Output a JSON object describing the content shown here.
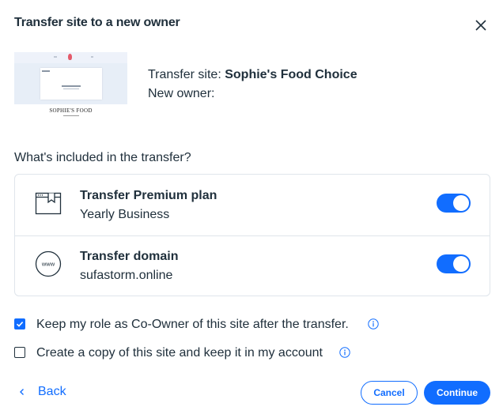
{
  "dialog": {
    "title": "Transfer site to a new owner"
  },
  "site": {
    "transfer_label": "Transfer site: ",
    "site_name": "Sophie's Food Choice",
    "new_owner_label": "New owner:",
    "thumbnail_caption": "SOPHIE'S FOOD"
  },
  "included": {
    "question": "What's included in the transfer?",
    "items": [
      {
        "title": "Transfer Premium plan",
        "subtitle": "Yearly Business",
        "icon": "browser-bookmark-icon",
        "enabled": true
      },
      {
        "title": "Transfer domain",
        "subtitle": "sufastorm.online",
        "icon": "www-globe-icon",
        "enabled": true
      }
    ]
  },
  "options": [
    {
      "label": "Keep my role as Co-Owner of this site after the transfer.",
      "checked": true
    },
    {
      "label": "Create a copy of this site and keep it in my account",
      "checked": false
    }
  ],
  "footer": {
    "back_label": "Back",
    "cancel_label": "Cancel",
    "continue_label": "Continue"
  },
  "colors": {
    "accent": "#116dff",
    "text": "#20303c",
    "border": "#dfe5eb"
  }
}
